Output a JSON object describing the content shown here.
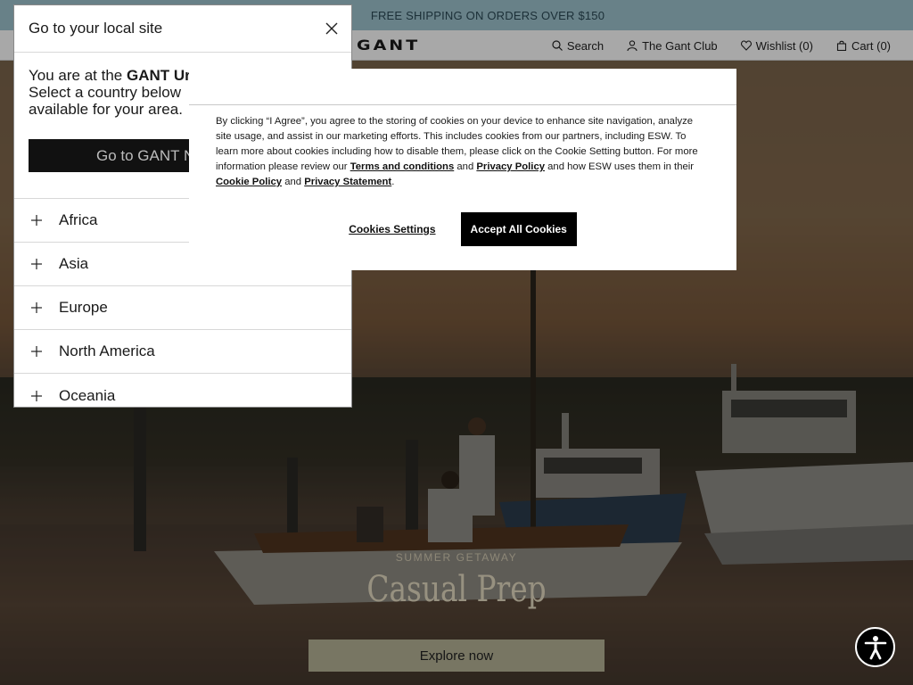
{
  "promo": {
    "text": "FREE SHIPPING ON ORDERS OVER $150"
  },
  "header": {
    "logo": "GANT",
    "nav": {
      "search": "Search",
      "club": "The Gant Club",
      "wishlist": "Wishlist (0)",
      "cart": "Cart (0)"
    }
  },
  "hero": {
    "kicker": "SUMMER GETAWAY",
    "headline": "Casual Prep",
    "cta": "Explore now"
  },
  "local_site": {
    "title": "Go to your local site",
    "body_prefix": "You are at the ",
    "body_bold": "GANT Ur",
    "body_line2": "Select a country below",
    "body_line3": "available for your area.",
    "button": "Go to GANT N",
    "regions": [
      {
        "label": "Africa"
      },
      {
        "label": "Asia"
      },
      {
        "label": "Europe"
      },
      {
        "label": "North America"
      },
      {
        "label": "Oceania"
      }
    ]
  },
  "cookie": {
    "text_1": "By clicking “I Agree”, you agree to the storing of cookies on your device to enhance site navigation, analyze site usage, and assist in our marketing efforts. This includes cookies from our partners, including ESW. To learn more about cookies including how to disable them, please click on the Cookie Setting button. For more information please review our ",
    "link_terms": "Terms and conditions",
    "and_1": " and ",
    "link_privacy": "Privacy Policy",
    "text_2": " and how ESW uses them in their ",
    "link_cookie_policy": "Cookie Policy",
    "and_2": " and ",
    "link_privacy_statement": "Privacy Statement",
    "period": ".",
    "settings_button": "Cookies Settings",
    "accept_button": "Accept All Cookies"
  },
  "icons": {
    "search": "search-icon",
    "user": "user-icon",
    "heart": "heart-icon",
    "bag": "bag-icon",
    "close": "close-icon",
    "plus": "plus-icon",
    "accessibility": "accessibility-icon"
  },
  "colors": {
    "promo_bg": "#9fc4cf",
    "cta_bg": "#b6b497",
    "accept_bg": "#000000"
  }
}
